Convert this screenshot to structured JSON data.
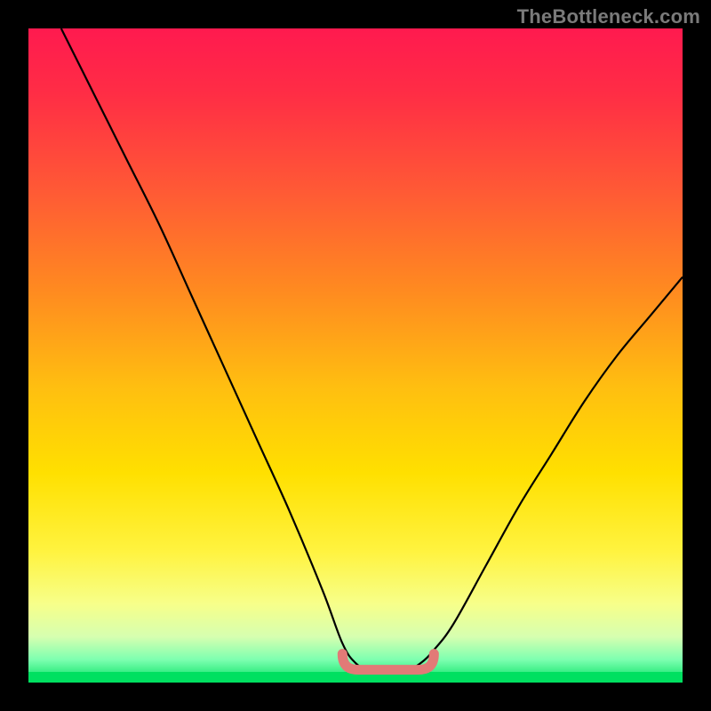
{
  "watermark": "TheBottleneck.com",
  "colors": {
    "frame": "#000000",
    "curve": "#000000",
    "flat_segment": "#e27a77",
    "top_band": "#00e060",
    "gradient_stops": [
      {
        "offset": 0.0,
        "color": "#ff1a4f"
      },
      {
        "offset": 0.1,
        "color": "#ff2d45"
      },
      {
        "offset": 0.25,
        "color": "#ff5a35"
      },
      {
        "offset": 0.4,
        "color": "#ff8a20"
      },
      {
        "offset": 0.55,
        "color": "#ffbf10"
      },
      {
        "offset": 0.68,
        "color": "#ffe000"
      },
      {
        "offset": 0.8,
        "color": "#fff340"
      },
      {
        "offset": 0.88,
        "color": "#f7ff8a"
      },
      {
        "offset": 0.93,
        "color": "#d6ffb0"
      },
      {
        "offset": 0.965,
        "color": "#7dffb0"
      },
      {
        "offset": 1.0,
        "color": "#00e060"
      }
    ]
  },
  "chart_data": {
    "type": "line",
    "title": "",
    "xlabel": "",
    "ylabel": "",
    "xlim": [
      0,
      100
    ],
    "ylim": [
      0,
      100
    ],
    "series": [
      {
        "name": "bottleneck-curve",
        "x": [
          5,
          10,
          15,
          20,
          25,
          30,
          35,
          40,
          45,
          48,
          50,
          52,
          55,
          58,
          60,
          62,
          65,
          70,
          75,
          80,
          85,
          90,
          95,
          100
        ],
        "y": [
          100,
          90,
          80,
          70,
          59,
          48,
          37,
          26,
          14,
          6,
          3,
          2,
          2,
          2,
          3,
          5,
          9,
          18,
          27,
          35,
          43,
          50,
          56,
          62
        ]
      }
    ],
    "flat_segment": {
      "x_start": 48,
      "x_end": 62,
      "y": 2.5
    }
  }
}
